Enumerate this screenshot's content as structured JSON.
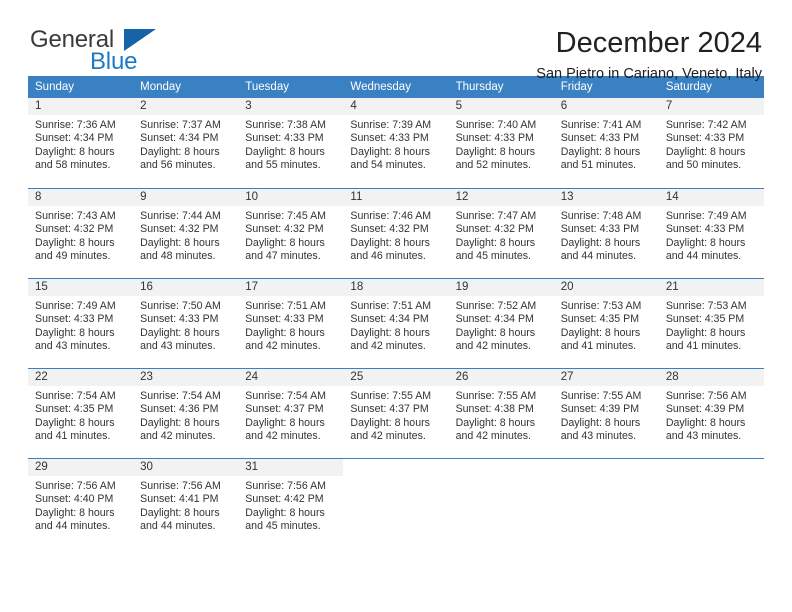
{
  "brand": {
    "name_part1": "General",
    "name_part2": "Blue",
    "logo_icon": "triangle-icon"
  },
  "header": {
    "title": "December 2024",
    "subtitle": "San Pietro in Cariano, Veneto, Italy"
  },
  "calendar": {
    "day_headers": [
      "Sunday",
      "Monday",
      "Tuesday",
      "Wednesday",
      "Thursday",
      "Friday",
      "Saturday"
    ],
    "accent_color": "#3a81c3",
    "daynum_band_color": "#f2f2f2",
    "weeks": [
      [
        {
          "day": "1",
          "sunrise": "Sunrise: 7:36 AM",
          "sunset": "Sunset: 4:34 PM",
          "daylight_line1": "Daylight: 8 hours",
          "daylight_line2": "and 58 minutes."
        },
        {
          "day": "2",
          "sunrise": "Sunrise: 7:37 AM",
          "sunset": "Sunset: 4:34 PM",
          "daylight_line1": "Daylight: 8 hours",
          "daylight_line2": "and 56 minutes."
        },
        {
          "day": "3",
          "sunrise": "Sunrise: 7:38 AM",
          "sunset": "Sunset: 4:33 PM",
          "daylight_line1": "Daylight: 8 hours",
          "daylight_line2": "and 55 minutes."
        },
        {
          "day": "4",
          "sunrise": "Sunrise: 7:39 AM",
          "sunset": "Sunset: 4:33 PM",
          "daylight_line1": "Daylight: 8 hours",
          "daylight_line2": "and 54 minutes."
        },
        {
          "day": "5",
          "sunrise": "Sunrise: 7:40 AM",
          "sunset": "Sunset: 4:33 PM",
          "daylight_line1": "Daylight: 8 hours",
          "daylight_line2": "and 52 minutes."
        },
        {
          "day": "6",
          "sunrise": "Sunrise: 7:41 AM",
          "sunset": "Sunset: 4:33 PM",
          "daylight_line1": "Daylight: 8 hours",
          "daylight_line2": "and 51 minutes."
        },
        {
          "day": "7",
          "sunrise": "Sunrise: 7:42 AM",
          "sunset": "Sunset: 4:33 PM",
          "daylight_line1": "Daylight: 8 hours",
          "daylight_line2": "and 50 minutes."
        }
      ],
      [
        {
          "day": "8",
          "sunrise": "Sunrise: 7:43 AM",
          "sunset": "Sunset: 4:32 PM",
          "daylight_line1": "Daylight: 8 hours",
          "daylight_line2": "and 49 minutes."
        },
        {
          "day": "9",
          "sunrise": "Sunrise: 7:44 AM",
          "sunset": "Sunset: 4:32 PM",
          "daylight_line1": "Daylight: 8 hours",
          "daylight_line2": "and 48 minutes."
        },
        {
          "day": "10",
          "sunrise": "Sunrise: 7:45 AM",
          "sunset": "Sunset: 4:32 PM",
          "daylight_line1": "Daylight: 8 hours",
          "daylight_line2": "and 47 minutes."
        },
        {
          "day": "11",
          "sunrise": "Sunrise: 7:46 AM",
          "sunset": "Sunset: 4:32 PM",
          "daylight_line1": "Daylight: 8 hours",
          "daylight_line2": "and 46 minutes."
        },
        {
          "day": "12",
          "sunrise": "Sunrise: 7:47 AM",
          "sunset": "Sunset: 4:32 PM",
          "daylight_line1": "Daylight: 8 hours",
          "daylight_line2": "and 45 minutes."
        },
        {
          "day": "13",
          "sunrise": "Sunrise: 7:48 AM",
          "sunset": "Sunset: 4:33 PM",
          "daylight_line1": "Daylight: 8 hours",
          "daylight_line2": "and 44 minutes."
        },
        {
          "day": "14",
          "sunrise": "Sunrise: 7:49 AM",
          "sunset": "Sunset: 4:33 PM",
          "daylight_line1": "Daylight: 8 hours",
          "daylight_line2": "and 44 minutes."
        }
      ],
      [
        {
          "day": "15",
          "sunrise": "Sunrise: 7:49 AM",
          "sunset": "Sunset: 4:33 PM",
          "daylight_line1": "Daylight: 8 hours",
          "daylight_line2": "and 43 minutes."
        },
        {
          "day": "16",
          "sunrise": "Sunrise: 7:50 AM",
          "sunset": "Sunset: 4:33 PM",
          "daylight_line1": "Daylight: 8 hours",
          "daylight_line2": "and 43 minutes."
        },
        {
          "day": "17",
          "sunrise": "Sunrise: 7:51 AM",
          "sunset": "Sunset: 4:33 PM",
          "daylight_line1": "Daylight: 8 hours",
          "daylight_line2": "and 42 minutes."
        },
        {
          "day": "18",
          "sunrise": "Sunrise: 7:51 AM",
          "sunset": "Sunset: 4:34 PM",
          "daylight_line1": "Daylight: 8 hours",
          "daylight_line2": "and 42 minutes."
        },
        {
          "day": "19",
          "sunrise": "Sunrise: 7:52 AM",
          "sunset": "Sunset: 4:34 PM",
          "daylight_line1": "Daylight: 8 hours",
          "daylight_line2": "and 42 minutes."
        },
        {
          "day": "20",
          "sunrise": "Sunrise: 7:53 AM",
          "sunset": "Sunset: 4:35 PM",
          "daylight_line1": "Daylight: 8 hours",
          "daylight_line2": "and 41 minutes."
        },
        {
          "day": "21",
          "sunrise": "Sunrise: 7:53 AM",
          "sunset": "Sunset: 4:35 PM",
          "daylight_line1": "Daylight: 8 hours",
          "daylight_line2": "and 41 minutes."
        }
      ],
      [
        {
          "day": "22",
          "sunrise": "Sunrise: 7:54 AM",
          "sunset": "Sunset: 4:35 PM",
          "daylight_line1": "Daylight: 8 hours",
          "daylight_line2": "and 41 minutes."
        },
        {
          "day": "23",
          "sunrise": "Sunrise: 7:54 AM",
          "sunset": "Sunset: 4:36 PM",
          "daylight_line1": "Daylight: 8 hours",
          "daylight_line2": "and 42 minutes."
        },
        {
          "day": "24",
          "sunrise": "Sunrise: 7:54 AM",
          "sunset": "Sunset: 4:37 PM",
          "daylight_line1": "Daylight: 8 hours",
          "daylight_line2": "and 42 minutes."
        },
        {
          "day": "25",
          "sunrise": "Sunrise: 7:55 AM",
          "sunset": "Sunset: 4:37 PM",
          "daylight_line1": "Daylight: 8 hours",
          "daylight_line2": "and 42 minutes."
        },
        {
          "day": "26",
          "sunrise": "Sunrise: 7:55 AM",
          "sunset": "Sunset: 4:38 PM",
          "daylight_line1": "Daylight: 8 hours",
          "daylight_line2": "and 42 minutes."
        },
        {
          "day": "27",
          "sunrise": "Sunrise: 7:55 AM",
          "sunset": "Sunset: 4:39 PM",
          "daylight_line1": "Daylight: 8 hours",
          "daylight_line2": "and 43 minutes."
        },
        {
          "day": "28",
          "sunrise": "Sunrise: 7:56 AM",
          "sunset": "Sunset: 4:39 PM",
          "daylight_line1": "Daylight: 8 hours",
          "daylight_line2": "and 43 minutes."
        }
      ],
      [
        {
          "day": "29",
          "sunrise": "Sunrise: 7:56 AM",
          "sunset": "Sunset: 4:40 PM",
          "daylight_line1": "Daylight: 8 hours",
          "daylight_line2": "and 44 minutes."
        },
        {
          "day": "30",
          "sunrise": "Sunrise: 7:56 AM",
          "sunset": "Sunset: 4:41 PM",
          "daylight_line1": "Daylight: 8 hours",
          "daylight_line2": "and 44 minutes."
        },
        {
          "day": "31",
          "sunrise": "Sunrise: 7:56 AM",
          "sunset": "Sunset: 4:42 PM",
          "daylight_line1": "Daylight: 8 hours",
          "daylight_line2": "and 45 minutes."
        },
        {
          "day": "",
          "sunrise": "",
          "sunset": "",
          "daylight_line1": "",
          "daylight_line2": ""
        },
        {
          "day": "",
          "sunrise": "",
          "sunset": "",
          "daylight_line1": "",
          "daylight_line2": ""
        },
        {
          "day": "",
          "sunrise": "",
          "sunset": "",
          "daylight_line1": "",
          "daylight_line2": ""
        },
        {
          "day": "",
          "sunrise": "",
          "sunset": "",
          "daylight_line1": "",
          "daylight_line2": ""
        }
      ]
    ]
  }
}
